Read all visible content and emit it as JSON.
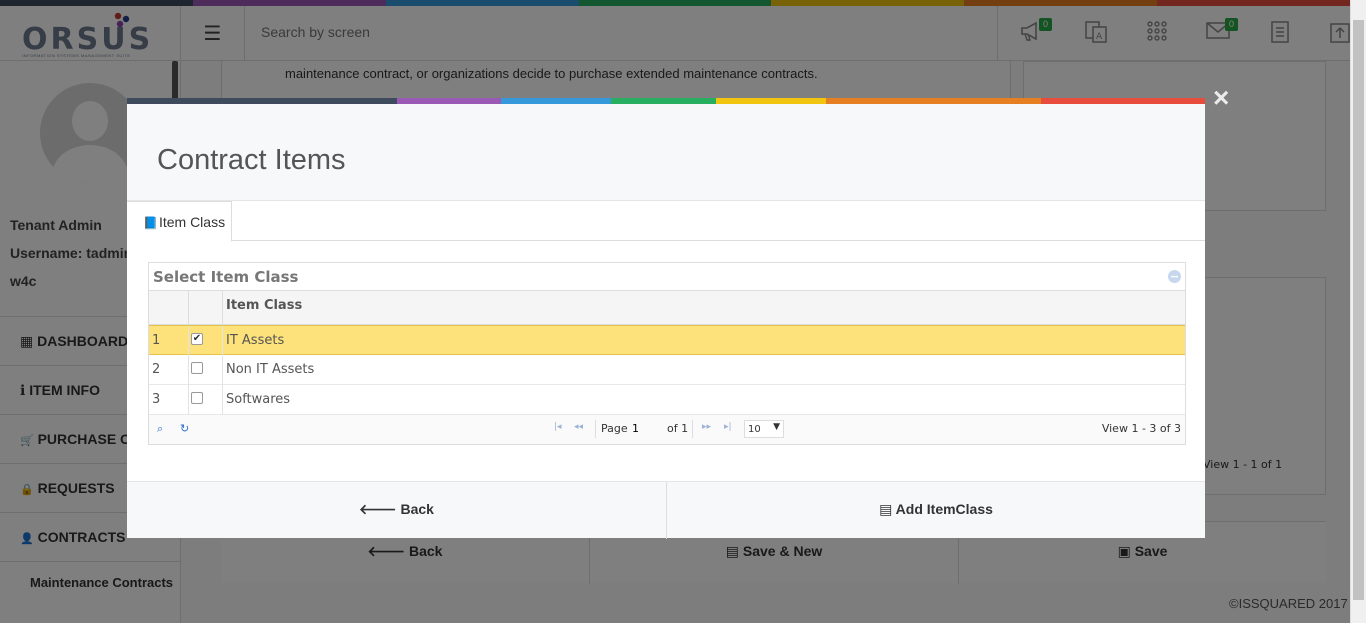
{
  "colors": {
    "strip": [
      "#3d4b5c",
      "#9b59b6",
      "#3498db",
      "#27ae60",
      "#f1c40f",
      "#e67e22",
      "#e74c3c"
    ],
    "badge": "#28a745",
    "selected_row": "#fde17b"
  },
  "header": {
    "logo_text": "ORSUS",
    "logo_sub": "INFORMATION SYSTEMS MANAGEMENT SUITE",
    "search_placeholder": "Search by screen",
    "icons": [
      {
        "name": "megaphone-icon",
        "glyph": "📢",
        "badge": "0"
      },
      {
        "name": "translate-icon",
        "glyph": "🈂"
      },
      {
        "name": "apps-grid-icon",
        "glyph": "⁙"
      },
      {
        "name": "mail-icon",
        "glyph": "✉",
        "badge": "0"
      },
      {
        "name": "document-icon",
        "glyph": "▤"
      },
      {
        "name": "upload-icon",
        "glyph": "⇪"
      }
    ]
  },
  "sidebar": {
    "user_role": "Tenant Admin",
    "username": "Username: tadmin",
    "org": "w4c",
    "nav": [
      {
        "label": "DASHBOARD",
        "icon": "▦"
      },
      {
        "label": "ITEM INFO",
        "icon": "ℹ"
      },
      {
        "label": "PURCHASE ORDERS",
        "icon": "🛒"
      },
      {
        "label": "REQUESTS",
        "icon": "🔒"
      },
      {
        "label": "CONTRACTS",
        "icon": "👤"
      }
    ],
    "sub_item": "Maintenance Contracts"
  },
  "background": {
    "text": "maintenance contract, or organizations decide to purchase extended maintenance contracts.",
    "right_view": "View 1 - 1 of 1",
    "back": "Back",
    "save_new": "Save & New",
    "save": "Save",
    "copyright": "©ISSQUARED 2017"
  },
  "modal": {
    "close": "×",
    "title": "Contract Items",
    "tab": "Item Class",
    "grid": {
      "caption": "Select Item Class",
      "column": "Item Class",
      "rows": [
        {
          "num": "1",
          "checked": true,
          "value": "IT Assets"
        },
        {
          "num": "2",
          "checked": false,
          "value": "Non IT Assets"
        },
        {
          "num": "3",
          "checked": false,
          "value": "Softwares"
        }
      ],
      "pager": {
        "page_label": "Page",
        "page_value": "1",
        "of": "of 1",
        "rows_per_page": "10",
        "view": "View 1 - 3 of 3"
      }
    },
    "back_label": "Back",
    "add_label": "Add ItemClass"
  }
}
